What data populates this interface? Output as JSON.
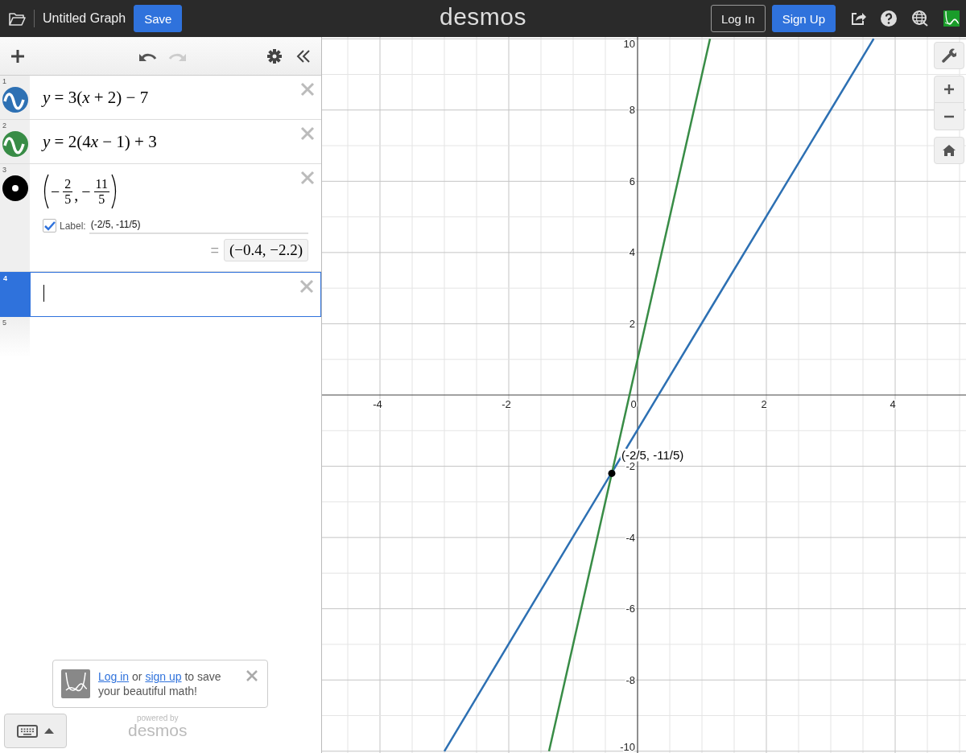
{
  "top_bar": {
    "title": "Untitled Graph",
    "save_button": "Save",
    "logo": "desmos",
    "login_button": "Log In",
    "signup_button": "Sign Up"
  },
  "toolbar": {
    "undo": {
      "disabled": false
    },
    "redo": {
      "disabled": true
    }
  },
  "expression_list": {
    "expressions": [
      {
        "number": "1",
        "kind": "graph",
        "color": "#2d70b3",
        "math": "y = 3(x + 2) − 7",
        "selected": false
      },
      {
        "number": "2",
        "kind": "graph",
        "color": "#388c46",
        "math": "y = 2(4x − 1) + 3",
        "selected": false
      },
      {
        "number": "3",
        "kind": "point",
        "color": "#000000",
        "separator": ",",
        "coords": [
          {
            "sign": "−",
            "num": "2",
            "den": "5"
          },
          {
            "sign": "−",
            "num": "11",
            "den": "5"
          }
        ],
        "label_option": {
          "checked": true,
          "caption": "Label:",
          "value": "(-2/5, -11/5)"
        },
        "result_equals": "=",
        "result": "(−0.4, −2.2)",
        "selected": false
      },
      {
        "number": "4",
        "kind": "empty",
        "selected": true
      },
      {
        "number": "5",
        "kind": "ghost",
        "selected": false
      }
    ]
  },
  "toast": {
    "segments": [
      {
        "text": "Log in",
        "link": true
      },
      {
        "text": " or ",
        "link": false
      },
      {
        "text": "sign up",
        "link": true
      },
      {
        "text": " to save your beautiful math!",
        "link": false
      }
    ]
  },
  "powered_by": {
    "caption": "powered by",
    "logo": "desmos"
  },
  "graph": {
    "chart_data": {
      "type": "line",
      "grid": true,
      "xlim": [
        -4.9,
        5.1
      ],
      "ylim": [
        -10.05,
        10.05
      ],
      "xticks": [
        {
          "value": -4,
          "label": "-4"
        },
        {
          "value": -2,
          "label": "-2"
        },
        {
          "value": 0,
          "label": "0"
        },
        {
          "value": 2,
          "label": "2"
        },
        {
          "value": 4,
          "label": "4"
        }
      ],
      "yticks": [
        {
          "value": -10,
          "label": "-10"
        },
        {
          "value": -8,
          "label": "-8"
        },
        {
          "value": -6,
          "label": "-6"
        },
        {
          "value": -4,
          "label": "-4"
        },
        {
          "value": -2,
          "label": "-2"
        },
        {
          "value": 2,
          "label": "2"
        },
        {
          "value": 4,
          "label": "4"
        },
        {
          "value": 6,
          "label": "6"
        },
        {
          "value": 8,
          "label": "8"
        },
        {
          "value": 10,
          "label": "10"
        }
      ],
      "x": [
        -3,
        -1.375,
        1.125,
        3.667
      ],
      "series": [
        {
          "color": "#2d70b3",
          "values": [
            -10,
            -5.1,
            2.4,
            10
          ]
        },
        {
          "color": "#388c46",
          "values": [
            null,
            -10,
            10,
            null
          ]
        }
      ],
      "annotations": [
        {
          "x": -0.4,
          "y": -2.2,
          "text": "(-2/5, -11/5)"
        }
      ]
    }
  }
}
